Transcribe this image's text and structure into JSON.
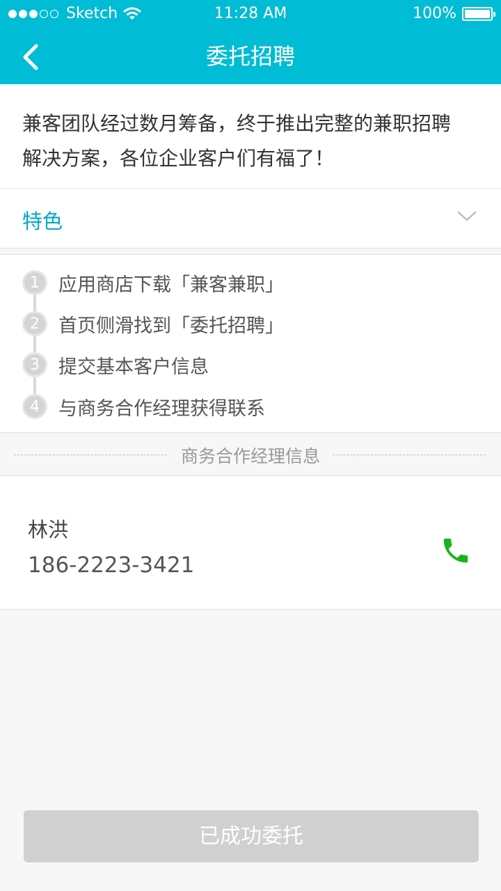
{
  "status_bar": {
    "carrier": "Sketch",
    "time": "11:28 AM",
    "battery": "100%",
    "signal_bars_filled": 3,
    "signal_bars_total": 5
  },
  "nav": {
    "title": "委托招聘",
    "back_icon": "chevron-left-icon"
  },
  "intro": {
    "line1": "兼客团队经过数月筹备，终于推出完整的兼职招聘",
    "line2": "解决方案，各位企业客户们有福了！"
  },
  "feature": {
    "label": "特色",
    "icon": "chevron-down-icon"
  },
  "steps": [
    {
      "num": "1",
      "text": "应用商店下载「兼客兼职」"
    },
    {
      "num": "2",
      "text": "首页侧滑找到「委托招聘」"
    },
    {
      "num": "3",
      "text": "提交基本客户信息"
    },
    {
      "num": "4",
      "text": "与商务合作经理获得联系"
    }
  ],
  "divider": {
    "label": "商务合作经理信息"
  },
  "manager": {
    "name": "林洪",
    "phone": "186-2223-3421",
    "call_icon": "phone-icon"
  },
  "submit": {
    "label": "已成功委托"
  },
  "colors": {
    "primary": "#00bcd4",
    "accent_text": "#00a8c6",
    "call_green": "#1ab41a",
    "disabled_button": "#d0d0d0"
  }
}
